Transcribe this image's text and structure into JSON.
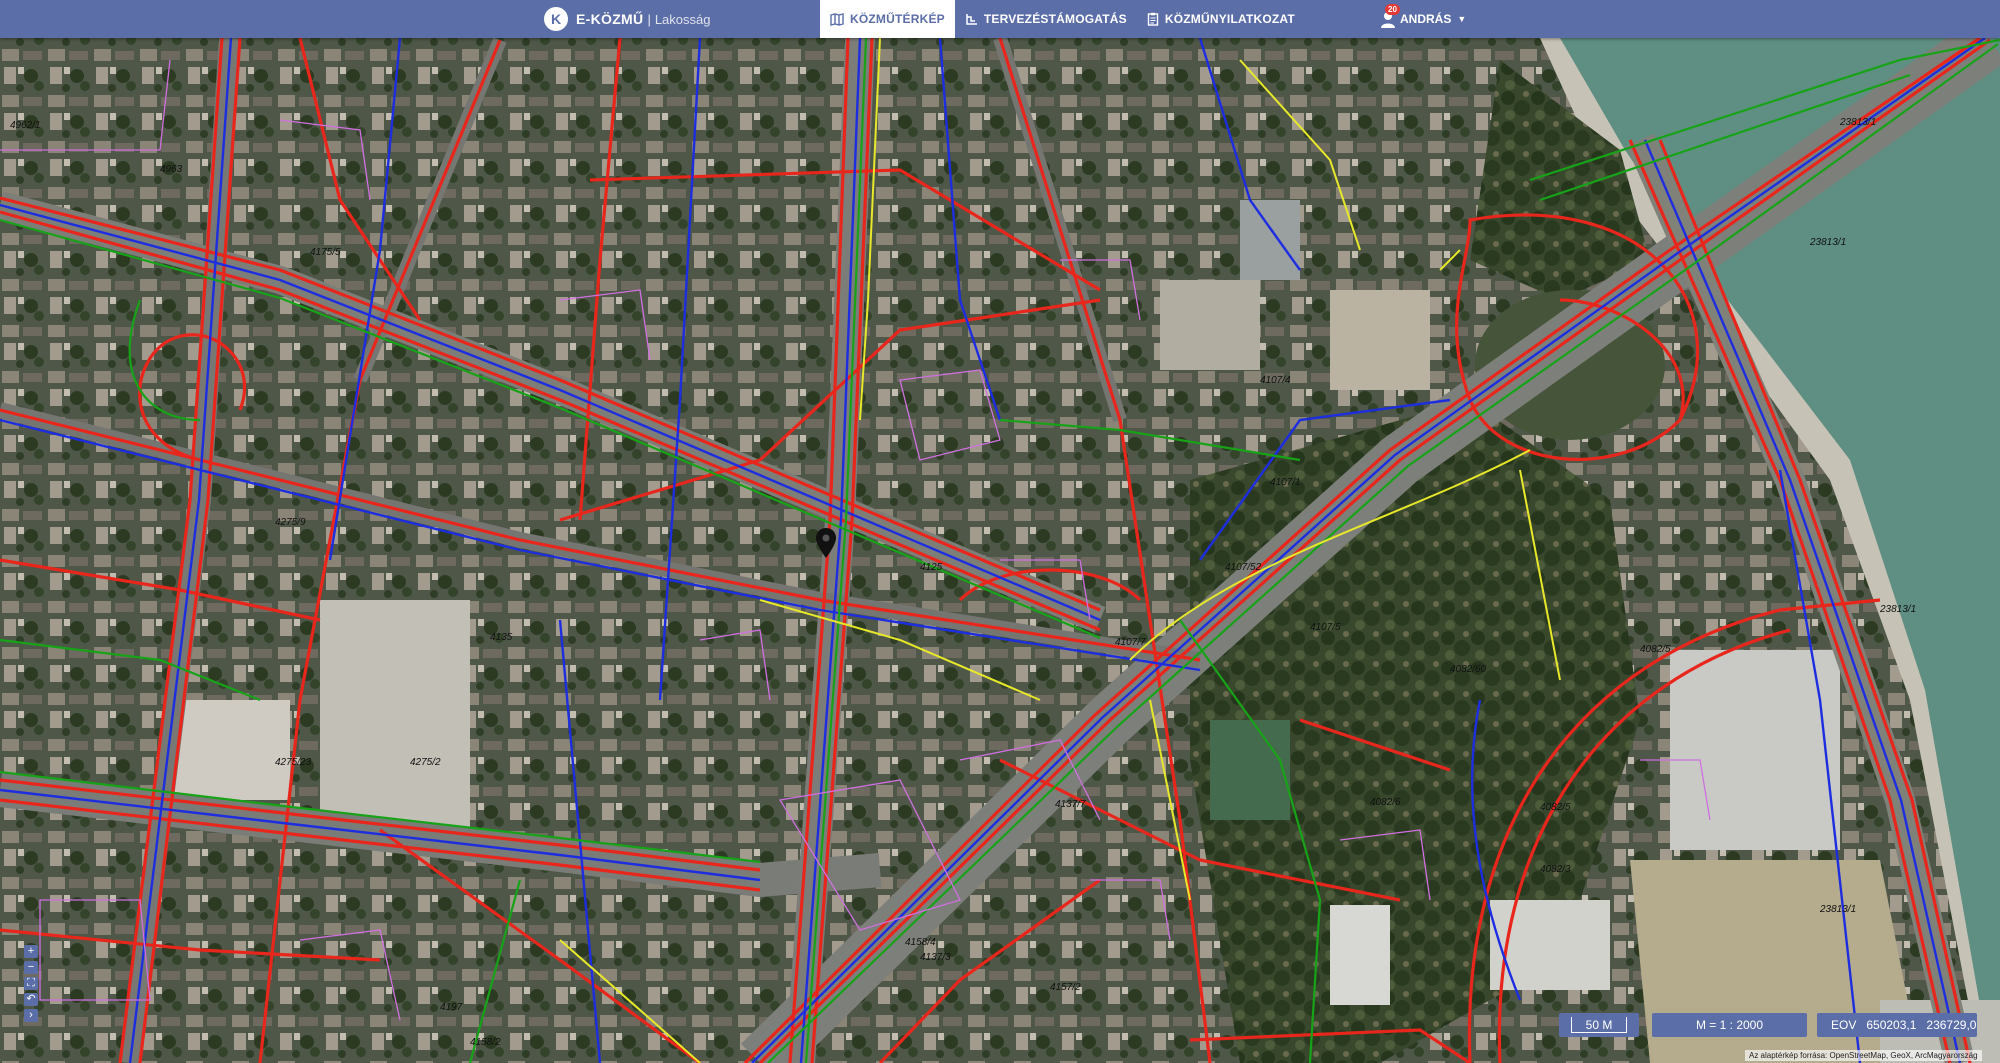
{
  "header": {
    "logo_letter": "K",
    "app_name": "E-KÖZMŰ",
    "separator": "|",
    "subtitle": "Lakosság",
    "nav": [
      {
        "label": "KÖZMŰTÉRKÉP",
        "icon": "map-icon",
        "active": true
      },
      {
        "label": "TERVEZÉSTÁMOGATÁS",
        "icon": "design-icon",
        "active": false
      },
      {
        "label": "KÖZMŰNYILATKOZAT",
        "icon": "clipboard-icon",
        "active": false
      }
    ],
    "user": {
      "name": "ANDRÁS",
      "badge_count": "20",
      "icon": "user-icon"
    }
  },
  "map_controls": {
    "zoom_in": "+",
    "zoom_out": "−",
    "fullscreen": "⛶",
    "undo": "↶",
    "expand": "›"
  },
  "status": {
    "scale_bar": "50 M",
    "scale_ratio": "M = 1 : 2000",
    "coord_label": "EOV",
    "coord_x": "650203,1",
    "coord_y": "236729,0"
  },
  "attribution": "Az alaptérkép forrása: OpenStreetMap, GeoX, ArcMagyarország",
  "parcel_labels": [
    "4962/1",
    "4963",
    "23813/1",
    "23813/1",
    "23813/1",
    "23813/1",
    "4275/9",
    "4275/23",
    "4275/2",
    "4107/4",
    "4107/1",
    "4107/52",
    "4107/5",
    "4107/7",
    "4082/60",
    "4082/6",
    "4082/5",
    "4082/3",
    "4082/5",
    "4137/7",
    "4157/2",
    "4137/3",
    "4158/4",
    "4158/2",
    "4197",
    "4135",
    "4125",
    "4175/5"
  ],
  "colors": {
    "header": "#5b6ea8",
    "utility_red": "#e8261c",
    "utility_blue": "#1d2de0",
    "utility_green": "#17a317",
    "utility_yellow": "#e8e82a",
    "parcel_magenta": "#d070e0",
    "water": "#5f8f82"
  }
}
